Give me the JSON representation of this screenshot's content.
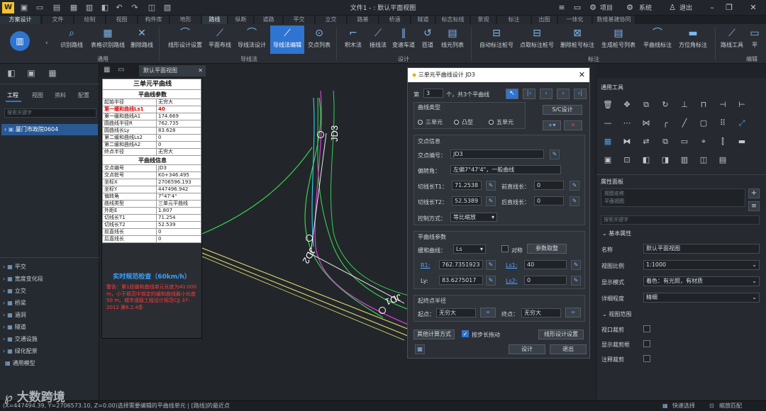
{
  "app": {
    "title": "文件1 - : 默认平面视图"
  },
  "title_right": {
    "project": "项目",
    "system": "系统",
    "logout": "退出"
  },
  "tabs": [
    "方案设计",
    "文件",
    "绘制",
    "视图",
    "构件库",
    "地形",
    "路线",
    "纵断",
    "道路",
    "平交",
    "立交",
    "路基",
    "桥涵",
    "隧道",
    "标志标线",
    "景观",
    "标注",
    "出图",
    "一体化",
    "数维基建协同"
  ],
  "ribbon": {
    "route_tools": [
      "识别路线",
      "表格识别路线",
      "删除路线"
    ],
    "route_group": "通用",
    "guide": [
      "线形设计设置",
      "平面布线",
      "导线法设计",
      "导线法编辑",
      "交点列表"
    ],
    "guide_group": "导线法",
    "design": [
      "积木法",
      "接线法",
      "变速车道",
      "匝道",
      "线元列表"
    ],
    "design_group": "设计",
    "mark": [
      "自动标注桩号",
      "点取标注桩号",
      "删除桩号标注",
      "生成桩号列表",
      "平曲线标注",
      "方位角标注"
    ],
    "mark_group": "标注",
    "route_tool": "路线工具",
    "edit_group": "编辑"
  },
  "left_panel": {
    "tabs": [
      "工程",
      "视图",
      "资料",
      "配置"
    ],
    "search_placeholder": "搜索关键字",
    "project": "厦门市政院0604",
    "tree": [
      "平交",
      "宽度变化段",
      "立交",
      "桥梁",
      "涵洞",
      "隧道",
      "交通设施",
      "绿化配景",
      "通用模型"
    ]
  },
  "doc_tab": "默认平面视图",
  "curve_panel": {
    "title": "三单元平曲线",
    "params_title": "平曲线参数",
    "params": [
      [
        "起始半径",
        "无穷大"
      ],
      [
        "第一缓和曲线Ls1",
        "40"
      ],
      [
        "第一缓和曲线A1",
        "174.669"
      ],
      [
        "圆曲线半径R",
        "762.735"
      ],
      [
        "圆曲线长Ly",
        "83.628"
      ],
      [
        "第二缓和曲线Ls2",
        "0"
      ],
      [
        "第二缓和曲线A2",
        "0"
      ],
      [
        "终点半径",
        "无穷大"
      ]
    ],
    "info_title": "平曲线信息",
    "info": [
      [
        "交点编号",
        "JD3"
      ],
      [
        "交点桩号",
        "K0+346.495"
      ],
      [
        "坐标X",
        "2706596.193"
      ],
      [
        "坐标Y",
        "447496.942"
      ],
      [
        "偏转角",
        "7°47'4\""
      ],
      [
        "曲线类型",
        "三单元平曲线"
      ],
      [
        "外距E",
        "1.807"
      ],
      [
        "切线长T1",
        "71.254"
      ],
      [
        "切线长T2",
        "52.539"
      ],
      [
        "前直线长",
        "0"
      ],
      [
        "后直线长",
        "0"
      ]
    ],
    "check_title": "实时规范检查（60km/h）",
    "warning": "警告：第1段缓和曲线单元长度为40.000 m，小于规范中规定的缓和曲线最小长度50 m。城市道路工程设计规范CJJ 37-2012 第6.2.4条"
  },
  "dialog": {
    "title": "三单元平曲线设计 JD3",
    "nav": {
      "prefix": "第",
      "index": "3",
      "suffix": "个，共3个平曲线"
    },
    "curve_type_label": "曲线类型",
    "types": [
      "三单元",
      "凸型",
      "五单元"
    ],
    "sc_btn": "S/C设计",
    "jd_section": "交点信息",
    "jd_no_label": "交点编号：",
    "jd_no": "JD3",
    "angle_label": "偏转角：",
    "angle": "左偏7°47'4\"，一般曲线",
    "t1_label": "切线长T1：",
    "t1": "71.2538",
    "pre_label": "前直线长：",
    "pre": "0",
    "t2_label": "切线长T2：",
    "t2": "52.5389",
    "post_label": "后直线长：",
    "post": "0",
    "ctrl_label": "控制方式：",
    "ctrl": "等比缩放",
    "pq_section": "平曲线参数",
    "ease_label": "缓和曲线：",
    "ease": "Ls",
    "sym_label": "对称",
    "ref_btn": "参数取整",
    "r1_label": "R1:",
    "r1": "762.7351923",
    "ls1_label": "Ls1:",
    "ls1": "40",
    "ly_label": "Ly:",
    "ly": "83.6275017",
    "ls2_label": "Ls2:",
    "ls2": "0",
    "radius_section": "起终点半径",
    "start_label": "起点：",
    "start": "无穷大",
    "end_label": "终点：",
    "end": "无穷大",
    "other_btn": "其他计算方式",
    "drag_label": "按步长拖动",
    "setting_btn": "线形设计设置",
    "design_btn": "设计",
    "exit_btn": "退出"
  },
  "right_panel": {
    "tools_title": "通用工具",
    "props_title": "属性面板",
    "view_name": "视图名称",
    "view_sub": "平面视图",
    "search_placeholder": "搜索关键字",
    "basic_title": "基本属性",
    "props": [
      [
        "名称",
        "默认平面视图"
      ],
      [
        "视图比例",
        "1:1000"
      ],
      [
        "显示模式",
        "着色：有光照，有材质"
      ],
      [
        "详细程度",
        "精细"
      ]
    ],
    "range_title": "视图范围",
    "checks": [
      "视口裁剪",
      "显示裁剪框",
      "注释裁剪"
    ]
  },
  "status": {
    "text": "(X=447494.39, Y=2706573.10, Z=0.00)选择需要编辑的平曲线单元 | [路线]的最近点",
    "quick": "快速选择",
    "zoom": "缩放匹配",
    "watermark": "大数跨境"
  },
  "canvas": {
    "labels": [
      "JD3",
      "JD2",
      "JD1"
    ]
  }
}
